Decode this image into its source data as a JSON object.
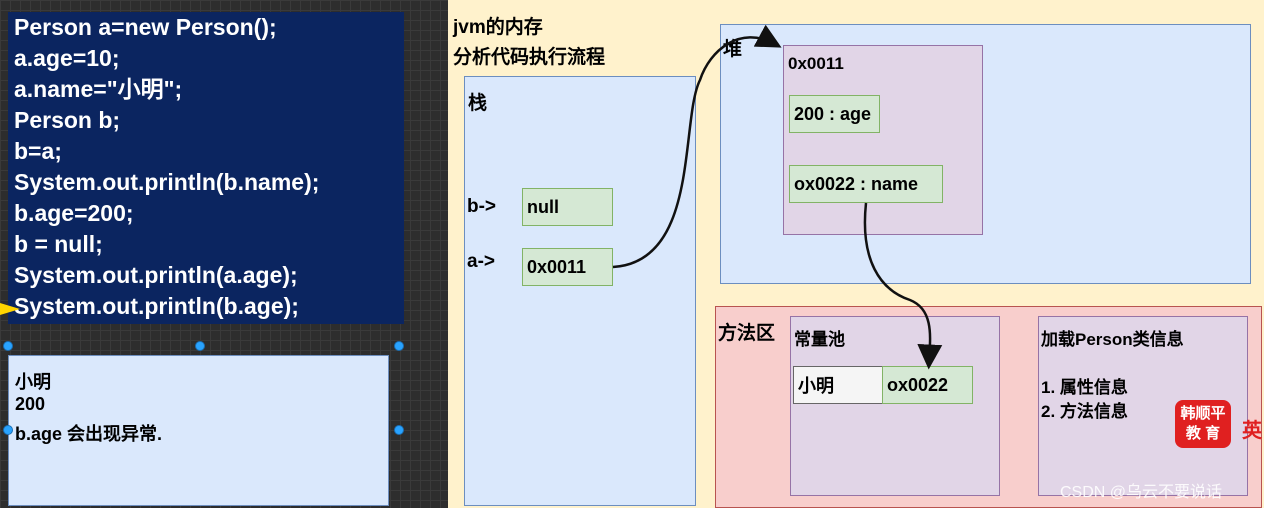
{
  "code": {
    "lines": [
      "Person a=new Person();",
      "a.age=10;",
      "a.name=\"小明\";",
      "Person b;",
      "b=a;",
      "System.out.println(b.name);",
      "b.age=200;",
      "b = null;",
      "System.out.println(a.age);",
      "System.out.println(b.age);"
    ]
  },
  "output": {
    "lines": [
      "小明",
      "200",
      "b.age 会出现异常."
    ]
  },
  "diagram": {
    "title_line1": "jvm的内存",
    "title_line2": "分析代码执行流程",
    "stack": {
      "label": "栈",
      "b_label": "b->",
      "b_value": "null",
      "a_label": "a->",
      "a_value": "0x0011"
    },
    "heap": {
      "label": "堆",
      "object_address": "0x0011",
      "age_field": "200 : age",
      "name_field": "ox0022 : name"
    },
    "method_area": {
      "label": "方法区",
      "constant_pool": {
        "label": "常量池",
        "string_value": "小明",
        "string_address": "ox0022"
      },
      "class_info": {
        "label": "加载Person类信息",
        "item1": "1. 属性信息",
        "item2": "2. 方法信息"
      }
    }
  },
  "branding": {
    "logo_line1": "韩顺平",
    "logo_line2": "教 育",
    "side_text": "英",
    "watermark": "CSDN @乌云不要说话"
  },
  "colors": {
    "code_bg": "#0b2560",
    "stack_bg": "#dae8fc",
    "object_bg": "#e1d5e7",
    "method_area_bg": "#f8cecc",
    "cell_bg": "#d5e8d4",
    "panel_bg": "#fff2cc"
  }
}
